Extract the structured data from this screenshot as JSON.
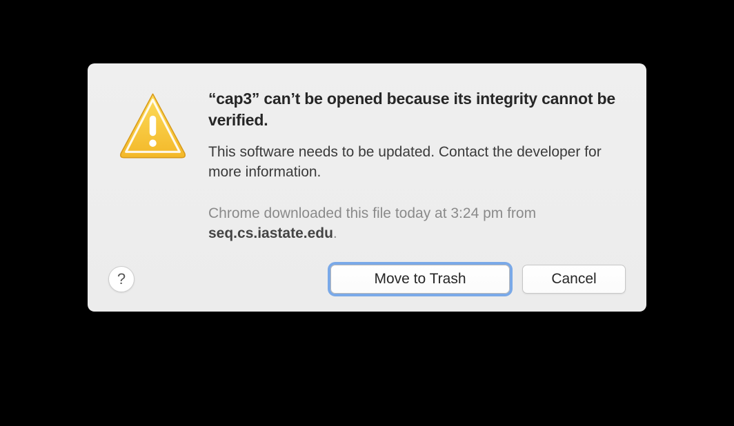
{
  "dialog": {
    "title": "“cap3” can’t be opened because its integrity cannot be verified.",
    "message": "This software needs to be updated. Contact the developer for more information.",
    "detail_prefix": "Chrome downloaded this file today at 3:24 pm from ",
    "detail_bold": "seq.cs.iastate.edu",
    "detail_suffix": ".",
    "help_label": "?",
    "primary_button": "Move to Trash",
    "secondary_button": "Cancel"
  }
}
